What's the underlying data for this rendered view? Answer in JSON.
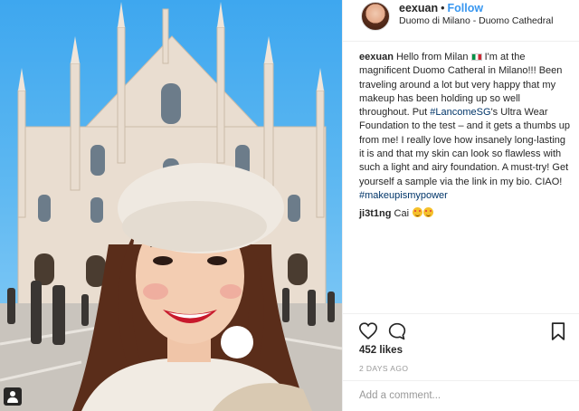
{
  "post": {
    "username": "eexuan",
    "separator": "•",
    "follow_label": "Follow",
    "location": "Duomo di Milano - Duomo Cathedral"
  },
  "caption": {
    "username": "eexuan",
    "text_part1": "Hello from Milan",
    "text_part2": "I'm at the magnificent Duomo Catheral in Milano!!! Been traveling around a lot but very happy that my makeup has been holding up so well throughout. Put",
    "hashtag1": "#LancomeSG",
    "text_part3": "'s Ultra Wear Foundation to the test – and it gets a thumbs up from me! I really love how insanely long-lasting it is and that my skin can look so flawless with such a light and airy foundation. A must-try! Get yourself a sample via the link in my bio. CIAO!",
    "hashtag2": "#makeupismypower"
  },
  "reply": {
    "username": "ji3t1ng",
    "text": "Cai"
  },
  "engagement": {
    "likes": "452 likes",
    "time": "2 DAYS AGO"
  },
  "comment_box": {
    "placeholder": "Add a comment..."
  },
  "icons": {
    "like": "heart-icon",
    "comment": "comment-bubble-icon",
    "save": "bookmark-icon",
    "tag": "user-tag-icon",
    "flag": "italy-flag-emoji",
    "reply_emoji": "heart-eyes-emoji"
  },
  "colors": {
    "follow": "#3897f0",
    "hashtag": "#003569",
    "muted": "#999999",
    "text": "#262626"
  }
}
